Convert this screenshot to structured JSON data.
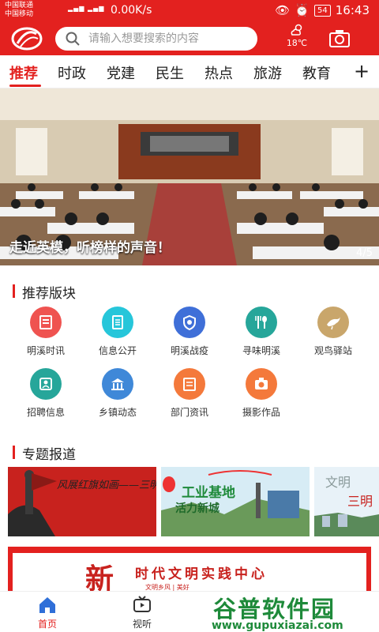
{
  "status_bar": {
    "carrier1": "中国联通",
    "carrier2": "中国移动",
    "speed": "0.00K/s",
    "battery": "54",
    "time": "16:43"
  },
  "header": {
    "search_placeholder": "请输入想要搜索的内容",
    "temperature": "18℃"
  },
  "tabs": [
    "推荐",
    "时政",
    "党建",
    "民生",
    "热点",
    "旅游",
    "教育"
  ],
  "tab_add": "+",
  "banner": {
    "caption": "走近英模，听榜样的声音！",
    "page": "4/5"
  },
  "recommend": {
    "title": "推荐版块",
    "items": [
      {
        "label": "明溪时讯",
        "icon": "news-icon",
        "color": "#ef5350"
      },
      {
        "label": "信息公开",
        "icon": "document-icon",
        "color": "#26c6da"
      },
      {
        "label": "明溪战疫",
        "icon": "shield-icon",
        "color": "#3f6fd8"
      },
      {
        "label": "寻味明溪",
        "icon": "fork-spoon-icon",
        "color": "#26a69a"
      },
      {
        "label": "观鸟驿站",
        "icon": "bird-icon",
        "color": "#c9a66b"
      },
      {
        "label": "招聘信息",
        "icon": "recruit-icon",
        "color": "#26a69a"
      },
      {
        "label": "乡镇动态",
        "icon": "building-icon",
        "color": "#3f88d8"
      },
      {
        "label": "部门资讯",
        "icon": "folder-icon",
        "color": "#f4793b"
      },
      {
        "label": "摄影作品",
        "icon": "camera-icon",
        "color": "#f4793b"
      }
    ]
  },
  "topics": {
    "title": "专题报道",
    "card1_text": "风展红旗如画——三明",
    "card2_text1": "工业基地",
    "card2_text2": "活力新城",
    "card3_text1": "文明",
    "card3_text2": "三明"
  },
  "bottom_banner": {
    "title": "时代文明实践中心",
    "big_char": "新",
    "sub": "文明乡风 | 美好"
  },
  "bottom_nav": [
    {
      "label": "首页",
      "icon": "home-icon"
    },
    {
      "label": "视听",
      "icon": "tv-icon"
    }
  ],
  "watermark": {
    "name": "谷普软件园",
    "url": "www.gupuxiazai.com"
  },
  "colors": {
    "brand": "#e3211f"
  }
}
